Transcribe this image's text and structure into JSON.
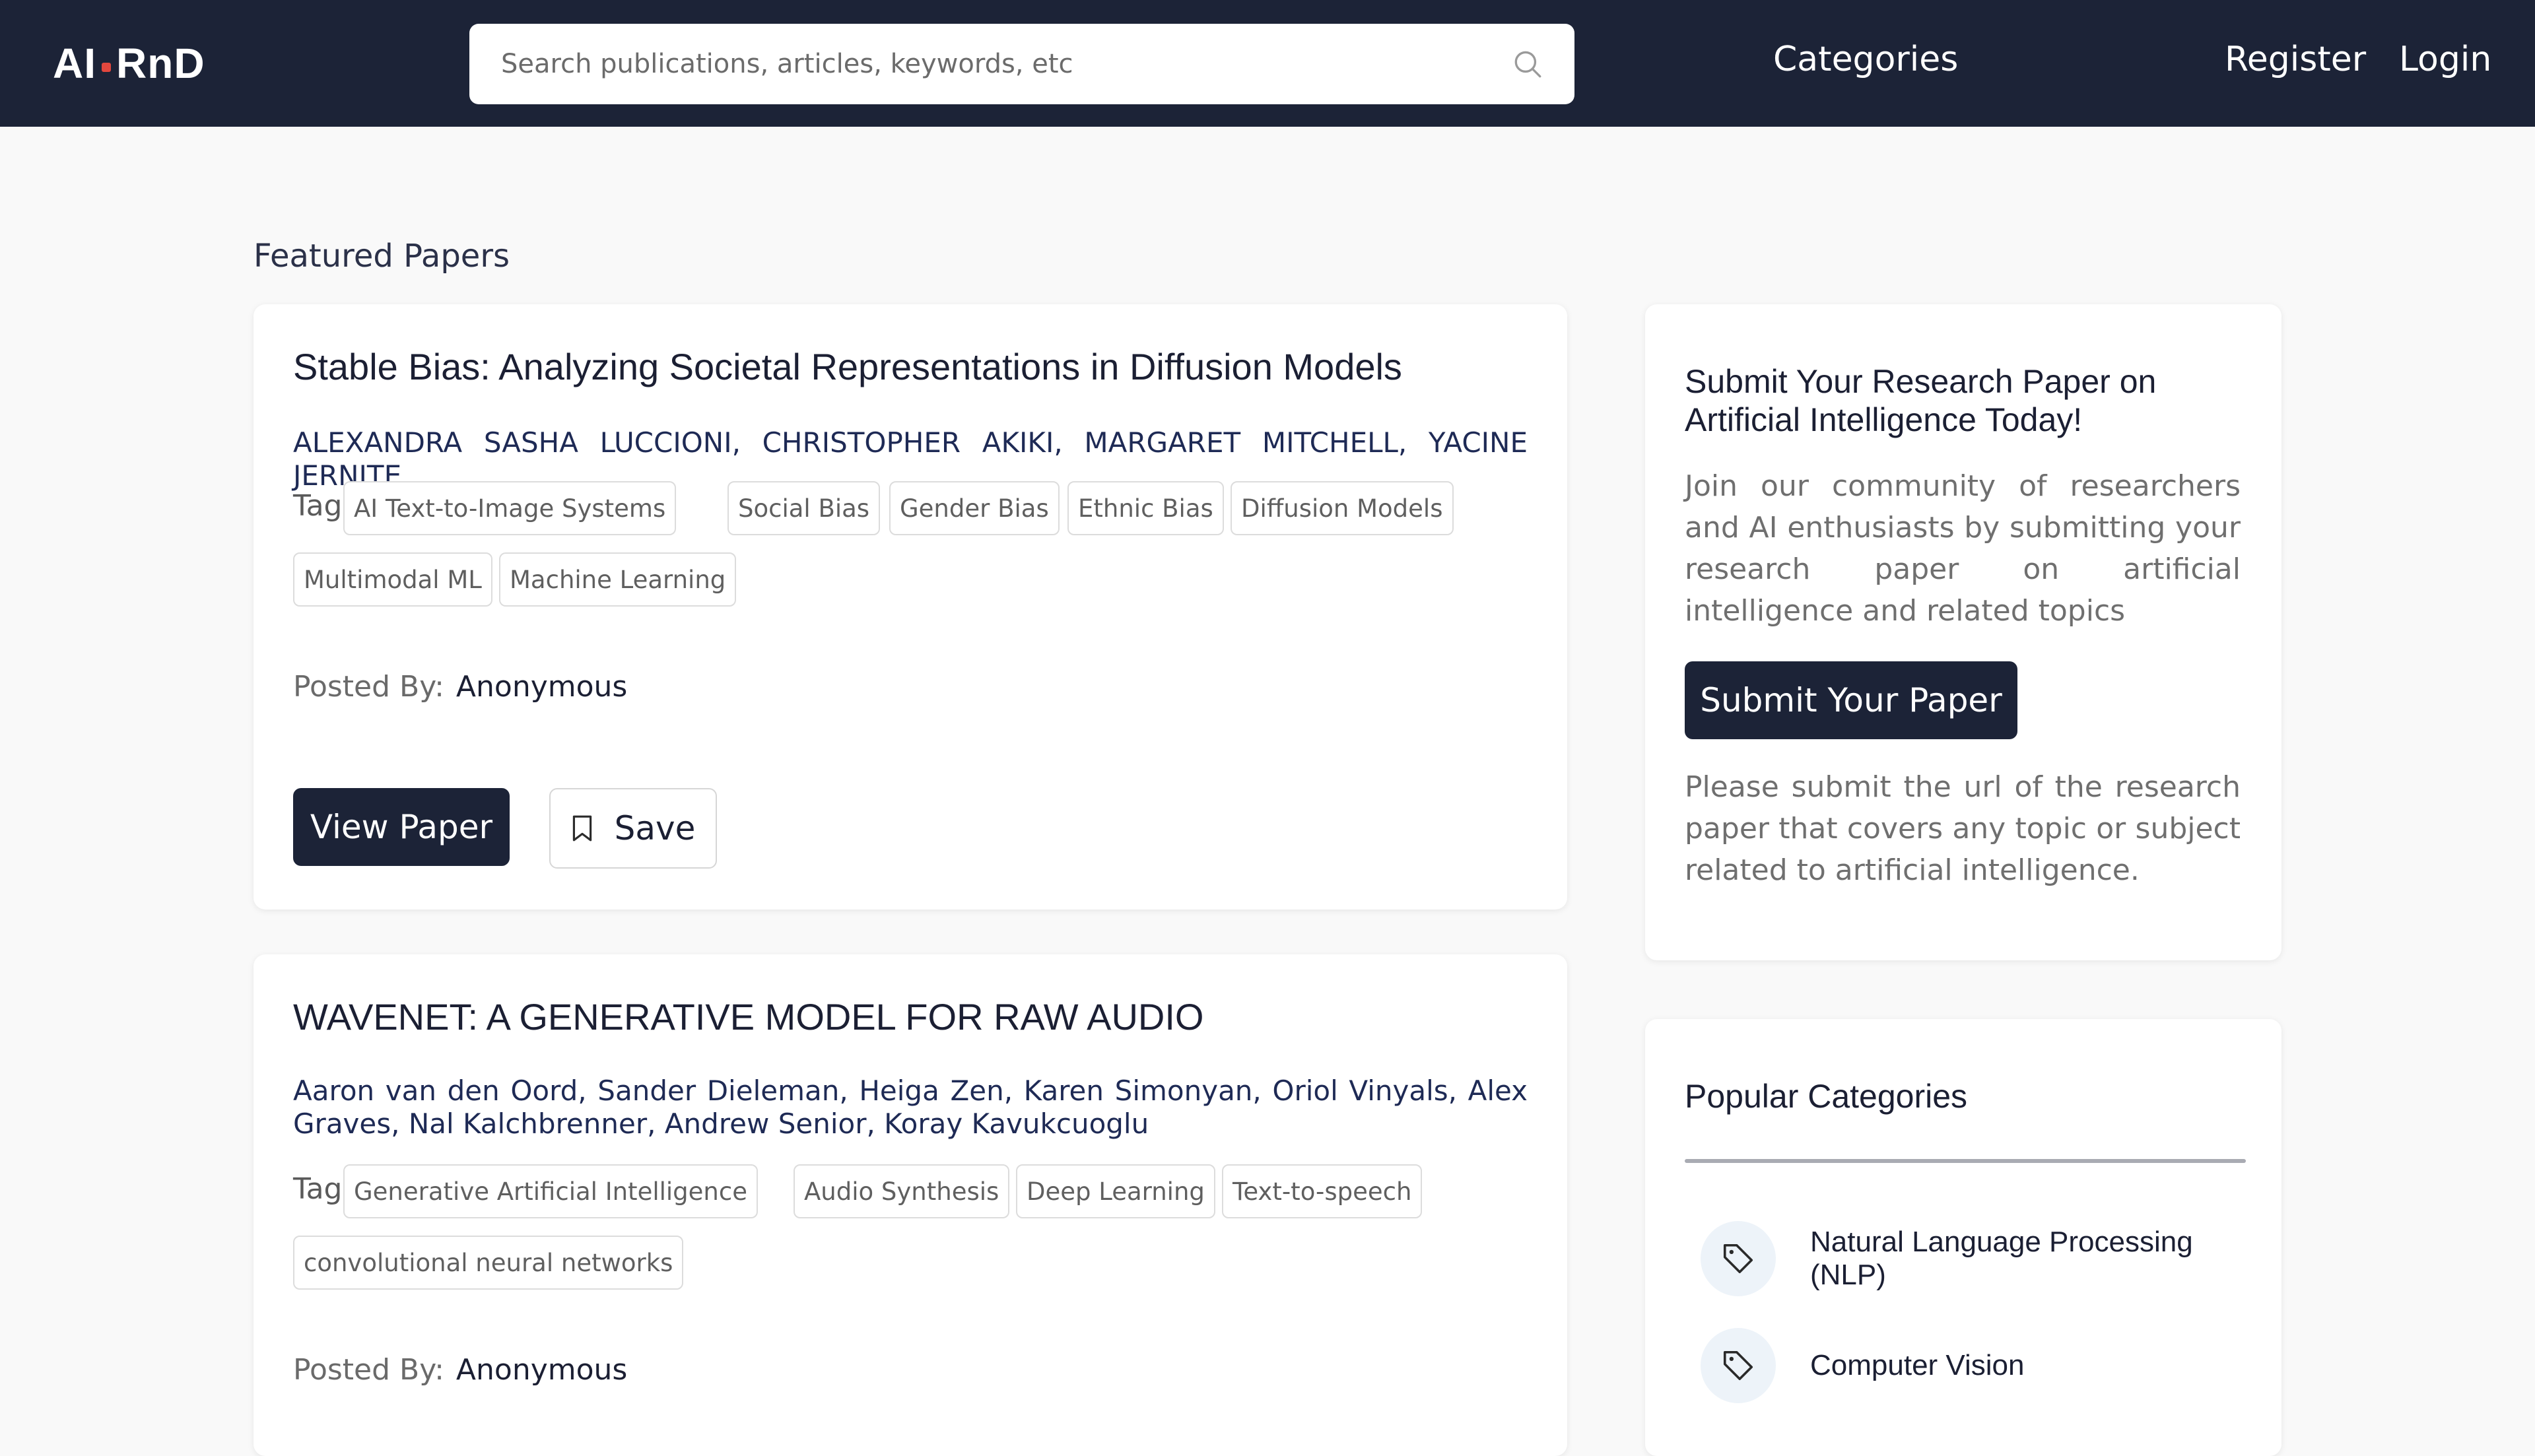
{
  "header": {
    "logo_left": "AI",
    "logo_right": "RnD",
    "search_placeholder": "Search publications, articles, keywords, etc",
    "nav": {
      "categories": "Categories",
      "register": "Register",
      "login": "Login"
    }
  },
  "main": {
    "section_title": "Featured Papers",
    "papers": [
      {
        "title": "Stable Bias: Analyzing Societal Representations in Diffusion Models",
        "authors": "ALEXANDRA SASHA LUCCIONI, CHRISTOPHER AKIKI, MARGARET MITCHELL, YACINE JERNITE",
        "tags_label": "Tags:",
        "tags": [
          "AI Text-to-Image Systems",
          "Social Bias",
          "Gender Bias",
          "Ethnic Bias",
          "Diffusion Models",
          "Multimodal ML",
          "Machine Learning"
        ],
        "posted_by_label": "Posted By:",
        "posted_by": "Anonymous",
        "view_label": "View Paper",
        "save_label": "Save"
      },
      {
        "title": "WAVENET: A GENERATIVE MODEL FOR RAW AUDIO",
        "authors": "Aaron van den Oord, Sander Dieleman, Heiga Zen, Karen Simonyan, Oriol Vinyals, Alex Graves, Nal Kalchbrenner, Andrew Senior, Koray Kavukcuoglu",
        "tags_label": "Tags:",
        "tags": [
          "Generative Artificial Intelligence",
          "Audio Synthesis",
          "Deep Learning",
          "Text-to-speech",
          "convolutional neural networks"
        ],
        "posted_by_label": "Posted By:",
        "posted_by": "Anonymous"
      }
    ]
  },
  "sidebar": {
    "submit": {
      "heading": "Submit Your Research Paper on Artificial Intelligence Today!",
      "description": "Join our community of researchers and AI enthusiasts by submitting your research paper on artificial intelligence and related topics",
      "button_label": "Submit Your Paper",
      "note": "Please submit the url of the research paper that covers any topic or subject related to artificial intelligence."
    },
    "popular": {
      "title": "Popular Categories",
      "items": [
        {
          "label": "Natural Language Processing (NLP)",
          "icon": "tag-icon"
        },
        {
          "label": "Computer Vision",
          "icon": "tag-icon"
        }
      ]
    }
  },
  "colors": {
    "header_bg": "#1c2337",
    "logo_accent": "#e2473e",
    "page_bg": "#f9f9f9",
    "button_dark": "#1c2337"
  }
}
